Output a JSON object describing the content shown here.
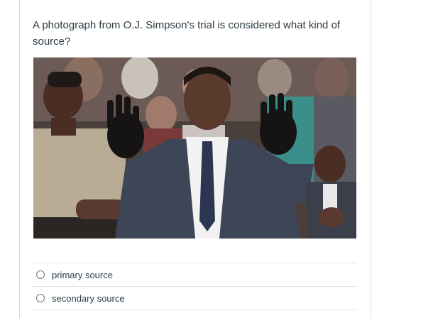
{
  "question": {
    "text": "A photograph from O.J. Simpson's trial is considered what kind of source?"
  },
  "answers": [
    {
      "label": "primary source",
      "selected": false
    },
    {
      "label": "secondary source",
      "selected": false
    }
  ],
  "colors": {
    "text": "#2d3b45",
    "border": "#e3e3e3",
    "radio_border": "#6b7780"
  }
}
